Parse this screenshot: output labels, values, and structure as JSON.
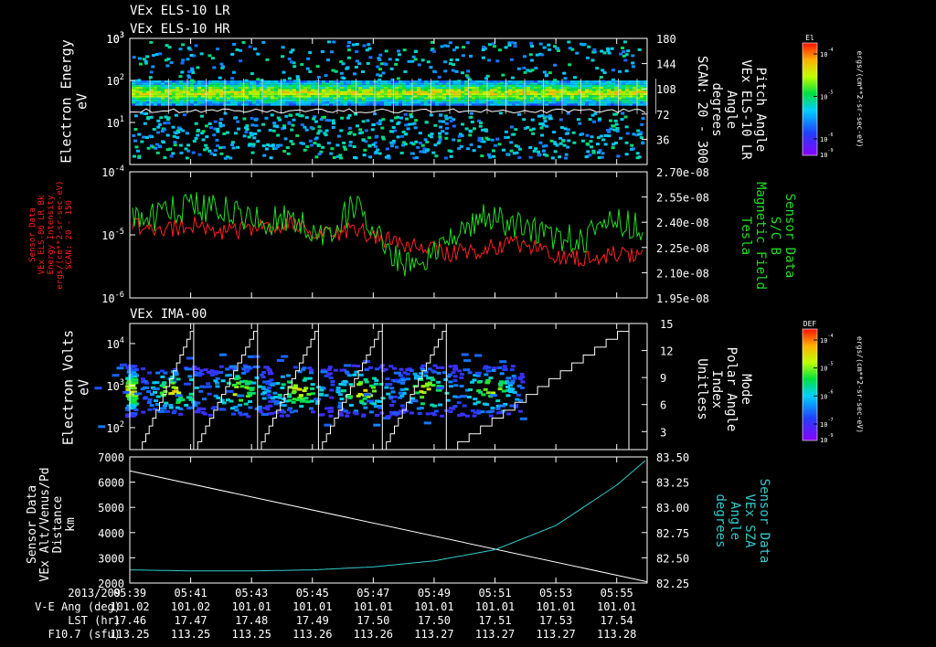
{
  "titles": {
    "line1": "VEx ELS-10 LR",
    "line2": "VEx ELS-10 HR",
    "panel3": "VEx IMA-00"
  },
  "chart_data": [
    {
      "type": "heatmap",
      "y_log": true,
      "ylim": [
        1,
        1000
      ],
      "ylabel_lines": [
        "Electron Energy",
        "eV"
      ],
      "y_ticks": [
        {
          "v": 10,
          "base": "10",
          "exp": "1"
        },
        {
          "v": 100,
          "base": "10",
          "exp": "2"
        },
        {
          "v": 1000,
          "base": "10",
          "exp": "3"
        }
      ],
      "right_axis": {
        "ylim": [
          0,
          180
        ],
        "ticks": [
          "36",
          "72",
          "108",
          "144",
          "180"
        ],
        "label_lines": [
          "Pitch Angle",
          "VEx ELS-10 LR",
          "Angle",
          "degrees",
          "SCAN: 20 - 300"
        ]
      },
      "colorbar": {
        "title": "El",
        "tick_values": [
          {
            "base": "10",
            "exp": "-4"
          },
          {
            "base": "10",
            "exp": "-5"
          },
          {
            "base": "10",
            "exp": "-6"
          }
        ],
        "bottom_label": {
          "base": "10",
          "exp": "-9"
        },
        "units": "ergs/(cm**2-sr-sec-eV)"
      },
      "band_energy_range": [
        25,
        90
      ],
      "scatter_energy_range": [
        1.5,
        18
      ],
      "white_trace_level_eV": 19
    },
    {
      "type": "line",
      "y_log": true,
      "ylim": [
        1e-06,
        0.0001
      ],
      "y_ticks": [
        {
          "v": 1e-06,
          "base": "10",
          "exp": "-6"
        },
        {
          "v": 1e-05,
          "base": "10",
          "exp": "-5"
        },
        {
          "v": 0.0001,
          "base": "10",
          "exp": "-4"
        }
      ],
      "left_label_lines": [
        "Sensor Data",
        "VEx ELS-06 LR Bk",
        "Energy Intensity",
        "ergs/(cm**2-sr-sec-eV)",
        "SCAN: 20 - 150"
      ],
      "left_label_color": "#ff2020",
      "right_axis": {
        "ylim": [
          1.95e-08,
          2.7e-08
        ],
        "ticks": [
          "1.95e-08",
          "2.10e-08",
          "2.25e-08",
          "2.40e-08",
          "2.55e-08",
          "2.70e-08"
        ],
        "label_lines": [
          "Sensor Data",
          "S/C B",
          "Magnetic Field",
          "Tesla"
        ],
        "label_color": "#22dd22"
      },
      "series": [
        {
          "color": "#ff2020",
          "t": [
            0,
            1,
            2,
            3,
            4,
            5,
            6,
            7,
            8,
            9,
            10,
            11,
            12,
            13,
            14,
            15,
            16
          ],
          "values": [
            1.5e-05,
            1.2e-05,
            1.5e-05,
            1.1e-05,
            1.3e-05,
            1.4e-05,
            1e-05,
            1.2e-05,
            8e-06,
            6e-06,
            5e-06,
            6e-06,
            7e-06,
            5e-06,
            4e-06,
            5e-06,
            4.5e-06
          ]
        },
        {
          "color": "#22dd22",
          "t": [
            0,
            1,
            2,
            3,
            4,
            5,
            6,
            7,
            8,
            9,
            10,
            11,
            12,
            13,
            14,
            15,
            16
          ],
          "values": [
            2.4e-08,
            2.45e-08,
            2.5e-08,
            2.48e-08,
            2.4e-08,
            2.42e-08,
            2.3e-08,
            2.52e-08,
            2.2e-08,
            2.12e-08,
            2.35e-08,
            2.42e-08,
            2.38e-08,
            2.32e-08,
            2.3e-08,
            2.42e-08,
            2.35e-08
          ]
        }
      ]
    },
    {
      "type": "heatmap",
      "y_log": true,
      "ylim": [
        30,
        30000
      ],
      "ylabel_lines": [
        "Electron Volts",
        "eV"
      ],
      "y_ticks": [
        {
          "v": 100,
          "base": "10",
          "exp": "2"
        },
        {
          "v": 1000,
          "base": "10",
          "exp": "3"
        },
        {
          "v": 10000,
          "base": "10",
          "exp": "4"
        }
      ],
      "right_axis": {
        "ylim": [
          1,
          15
        ],
        "ticks": [
          "3",
          "6",
          "9",
          "12",
          "15"
        ],
        "label_lines": [
          "Mode",
          "Polar Angle",
          "Index",
          "Unitless"
        ]
      },
      "colorbar": {
        "title": "DEF",
        "tick_values": [
          {
            "base": "10",
            "exp": "-4"
          },
          {
            "base": "10",
            "exp": "-5"
          },
          {
            "base": "10",
            "exp": "-6"
          },
          {
            "base": "10",
            "exp": "-7"
          }
        ],
        "bottom_label": {
          "base": "10",
          "exp": "-9"
        },
        "units": "ergs/(cm**2-sr-sec-eV)"
      },
      "blob_centers_t": [
        0.0,
        1.1,
        3.2,
        5.2,
        7.3,
        9.4,
        11.5
      ],
      "blob_center_energy_eV": 800,
      "mode_resets_t": [
        2.1,
        4.2,
        6.2,
        8.3,
        10.4
      ]
    },
    {
      "type": "line",
      "ylim": [
        2000,
        7000
      ],
      "y_ticks": [
        "2000",
        "3000",
        "4000",
        "5000",
        "6000",
        "7000"
      ],
      "left_label_lines": [
        "Sensor Data",
        "VEx Alt/Venus/Pd",
        "Distance",
        "km"
      ],
      "right_axis": {
        "ylim": [
          82.25,
          83.5
        ],
        "ticks": [
          "82.25",
          "82.50",
          "82.75",
          "83.00",
          "83.25",
          "83.50"
        ],
        "label_lines": [
          "Sensor Data",
          "VEx SZA",
          "Angle",
          "degrees"
        ],
        "label_color": "#33cccc"
      },
      "series": [
        {
          "color": "#ffffff",
          "t": [
            0,
            17
          ],
          "values": [
            6450,
            2050
          ]
        },
        {
          "color": "#33cccc",
          "t": [
            0,
            2,
            4,
            6,
            8,
            10,
            12,
            14,
            16,
            17
          ],
          "values": [
            82.38,
            82.37,
            82.37,
            82.38,
            82.41,
            82.47,
            82.58,
            82.82,
            83.22,
            83.48
          ]
        }
      ]
    }
  ],
  "time_axis": {
    "t_range": [
      0,
      17
    ],
    "tick_t": [
      0,
      2,
      4,
      6,
      8,
      10,
      12,
      14,
      16
    ],
    "rows": [
      {
        "label": "2013/209",
        "values": [
          "05:39",
          "05:41",
          "05:43",
          "05:45",
          "05:47",
          "05:49",
          "05:51",
          "05:53",
          "05:55"
        ]
      },
      {
        "label": "V-E Ang (deg)",
        "values": [
          "101.02",
          "101.02",
          "101.01",
          "101.01",
          "101.01",
          "101.01",
          "101.01",
          "101.01",
          "101.01"
        ]
      },
      {
        "label": "LST (hr)",
        "values": [
          "17.46",
          "17.47",
          "17.48",
          "17.49",
          "17.50",
          "17.50",
          "17.51",
          "17.53",
          "17.54"
        ]
      },
      {
        "label": "F10.7 (sfu)",
        "values": [
          "113.25",
          "113.25",
          "113.25",
          "113.26",
          "113.26",
          "113.27",
          "113.27",
          "113.27",
          "113.28"
        ]
      }
    ]
  }
}
